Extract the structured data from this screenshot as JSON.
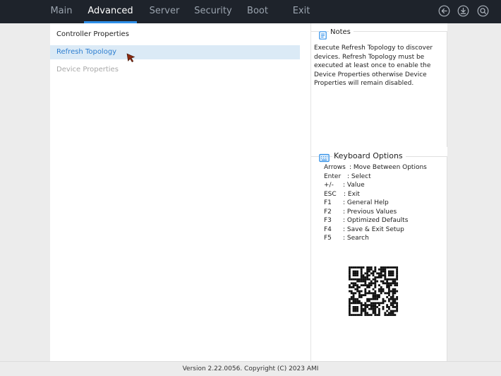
{
  "tabs": [
    {
      "label": "Main"
    },
    {
      "label": "Advanced"
    },
    {
      "label": "Server"
    },
    {
      "label": "Security"
    },
    {
      "label": "Boot"
    },
    {
      "label": "Exit"
    }
  ],
  "active_tab": "Advanced",
  "top_icons": [
    "back-arrow-icon",
    "download-icon",
    "search-icon"
  ],
  "menu": {
    "items": [
      {
        "label": "Controller Properties",
        "state": "normal"
      },
      {
        "label": "Refresh Topology",
        "state": "selected"
      },
      {
        "label": "Device Properties",
        "state": "disabled"
      }
    ]
  },
  "notes": {
    "title": "Notes",
    "text": "Execute Refresh Topology to discover devices. Refresh Topology must be executed at least once to enable the Device Properties otherwise Device Properties will remain disabled."
  },
  "keyboard": {
    "title": "Keyboard Options",
    "options": [
      {
        "key": "Arrows",
        "desc": ": Move Between Options"
      },
      {
        "key": "Enter",
        "desc": ": Select"
      },
      {
        "key": "+/-",
        "desc": ": Value"
      },
      {
        "key": "ESC",
        "desc": ": Exit"
      },
      {
        "key": "F1",
        "desc": ": General Help"
      },
      {
        "key": "F2",
        "desc": ": Previous Values"
      },
      {
        "key": "F3",
        "desc": ": Optimized Defaults"
      },
      {
        "key": "F4",
        "desc": ": Save & Exit Setup"
      },
      {
        "key": "F5",
        "desc": ": Search"
      }
    ]
  },
  "footer": {
    "version": "Version 2.22.0056. Copyright (C) 2023 AMI"
  },
  "colors": {
    "topbar": "#1e232b",
    "accent": "#2f8fe8",
    "selected_bg": "#dbeaf6",
    "selected_text": "#2e7fd1",
    "disabled_text": "#a8a8a8",
    "cursor": "#8b2a10"
  }
}
